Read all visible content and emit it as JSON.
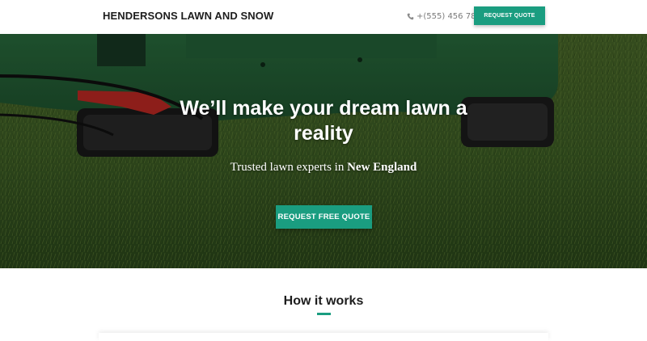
{
  "header": {
    "brand": "HENDERSONS LAWN AND SNOW",
    "phone": "+(555) 456 789",
    "cta_label": "REQUEST QUOTE"
  },
  "hero": {
    "title": "We’ll make your dream lawn a reality",
    "subtitle_prefix": "Trusted lawn experts in ",
    "subtitle_region": "New England",
    "cta_label": "REQUEST FREE QUOTE",
    "image": "lawn-mower-on-grass"
  },
  "how_it_works": {
    "title": "How it works"
  },
  "colors": {
    "accent": "#1a9d80",
    "grass": "#3c5a26",
    "mower_body": "#2f7a45",
    "mower_lever": "#c42a24"
  },
  "icons": {
    "phone": "phone-icon"
  }
}
